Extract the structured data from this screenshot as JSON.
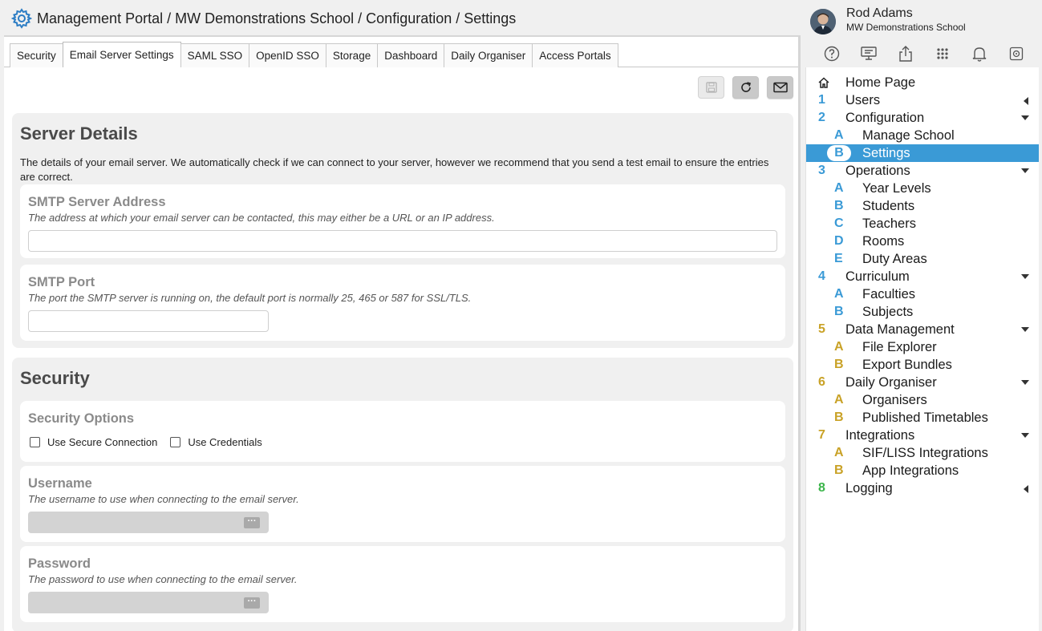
{
  "header": {
    "title": "Management Portal / MW Demonstrations School / Configuration / Settings"
  },
  "user": {
    "name": "Rod Adams",
    "school": "MW Demonstrations School"
  },
  "tabs": [
    "Security",
    "Email Server Settings",
    "SAML SSO",
    "OpenID SSO",
    "Storage",
    "Dashboard",
    "Daily Organiser",
    "Access Portals"
  ],
  "active_tab": "Email Server Settings",
  "server_details": {
    "heading": "Server Details",
    "description": "The details of your email server. We automatically check if we can connect to your server, however we recommend that you send a test email to ensure the entries are correct.",
    "smtp_address": {
      "label": "SMTP Server Address",
      "hint": "The address at which your email server can be contacted, this may either be a URL or an IP address.",
      "value": ""
    },
    "smtp_port": {
      "label": "SMTP Port",
      "hint": "The port the SMTP server is running on, the default port is normally 25, 465 or 587 for SSL/TLS.",
      "value": ""
    }
  },
  "security": {
    "heading": "Security",
    "options_label": "Security Options",
    "use_secure_connection": {
      "label": "Use Secure Connection",
      "checked": false
    },
    "use_credentials": {
      "label": "Use Credentials",
      "checked": false
    },
    "username": {
      "label": "Username",
      "hint": "The username to use when connecting to the email server.",
      "value": ""
    },
    "password": {
      "label": "Password",
      "hint": "The password to use when connecting to the email server.",
      "value": ""
    }
  },
  "nav": [
    {
      "num": "",
      "label": "Home Page",
      "level": 0,
      "icon": "home-icon"
    },
    {
      "num": "1",
      "label": "Users",
      "level": 0,
      "color": "blue",
      "arrow": "left"
    },
    {
      "num": "2",
      "label": "Configuration",
      "level": 0,
      "color": "blue",
      "arrow": "down"
    },
    {
      "num": "A",
      "label": "Manage School",
      "level": 1,
      "color": "blue"
    },
    {
      "num": "B",
      "label": "Settings",
      "level": 1,
      "color": "blue",
      "selected": true
    },
    {
      "num": "3",
      "label": "Operations",
      "level": 0,
      "color": "blue",
      "arrow": "down"
    },
    {
      "num": "A",
      "label": "Year Levels",
      "level": 1,
      "color": "blue"
    },
    {
      "num": "B",
      "label": "Students",
      "level": 1,
      "color": "blue"
    },
    {
      "num": "C",
      "label": "Teachers",
      "level": 1,
      "color": "blue"
    },
    {
      "num": "D",
      "label": "Rooms",
      "level": 1,
      "color": "blue"
    },
    {
      "num": "E",
      "label": "Duty Areas",
      "level": 1,
      "color": "blue"
    },
    {
      "num": "4",
      "label": "Curriculum",
      "level": 0,
      "color": "blue",
      "arrow": "down"
    },
    {
      "num": "A",
      "label": "Faculties",
      "level": 1,
      "color": "blue"
    },
    {
      "num": "B",
      "label": "Subjects",
      "level": 1,
      "color": "blue"
    },
    {
      "num": "5",
      "label": "Data Management",
      "level": 0,
      "color": "gold",
      "arrow": "down"
    },
    {
      "num": "A",
      "label": "File Explorer",
      "level": 1,
      "color": "gold"
    },
    {
      "num": "B",
      "label": "Export Bundles",
      "level": 1,
      "color": "gold"
    },
    {
      "num": "6",
      "label": "Daily Organiser",
      "level": 0,
      "color": "gold",
      "arrow": "down"
    },
    {
      "num": "A",
      "label": "Organisers",
      "level": 1,
      "color": "gold"
    },
    {
      "num": "B",
      "label": "Published Timetables",
      "level": 1,
      "color": "gold"
    },
    {
      "num": "7",
      "label": "Integrations",
      "level": 0,
      "color": "gold",
      "arrow": "down"
    },
    {
      "num": "A",
      "label": "SIF/LISS Integrations",
      "level": 1,
      "color": "gold"
    },
    {
      "num": "B",
      "label": "App Integrations",
      "level": 1,
      "color": "gold"
    },
    {
      "num": "8",
      "label": "Logging",
      "level": 0,
      "color": "green",
      "arrow": "left"
    }
  ],
  "colors": {
    "accent_blue": "#3a9ad6",
    "accent_gold": "#c9a227",
    "accent_green": "#3bb54a"
  }
}
